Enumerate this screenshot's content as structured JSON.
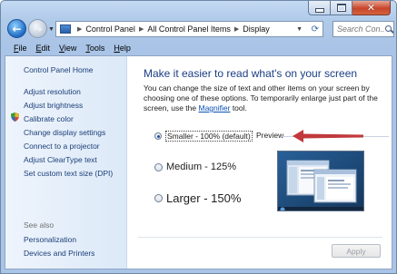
{
  "window": {
    "title": "Display"
  },
  "address": {
    "crumbs": [
      "Control Panel",
      "All Control Panel Items",
      "Display"
    ]
  },
  "search": {
    "placeholder": "Search Con..."
  },
  "menu": {
    "items": [
      {
        "accel": "F",
        "rest": "ile"
      },
      {
        "accel": "E",
        "rest": "dit"
      },
      {
        "accel": "V",
        "rest": "iew"
      },
      {
        "accel": "T",
        "rest": "ools"
      },
      {
        "accel": "H",
        "rest": "elp"
      }
    ]
  },
  "sidebar": {
    "home": "Control Panel Home",
    "links": [
      "Adjust resolution",
      "Adjust brightness",
      "Calibrate color",
      "Change display settings",
      "Connect to a projector",
      "Adjust ClearType text",
      "Set custom text size (DPI)"
    ],
    "see_also_label": "See also",
    "see_also": [
      "Personalization",
      "Devices and Printers"
    ]
  },
  "main": {
    "heading": "Make it easier to read what's on your screen",
    "desc_before": "You can change the size of text and other items on your screen by choosing one of these options. To temporarily enlarge just part of the screen, use the ",
    "magnifier_link": "Magnifier",
    "desc_after": " tool.",
    "options": [
      {
        "label": "Smaller - 100% (default)",
        "checked": true
      },
      {
        "label": "Medium - 125%",
        "checked": false
      },
      {
        "label": "Larger - 150%",
        "checked": false
      }
    ],
    "preview_label": "Preview",
    "apply_label": "Apply",
    "apply_enabled": false
  },
  "colors": {
    "link": "#1c3f78",
    "heading": "#1a3d84",
    "arrow": "#c0393c",
    "close_button": "#c7452a"
  }
}
